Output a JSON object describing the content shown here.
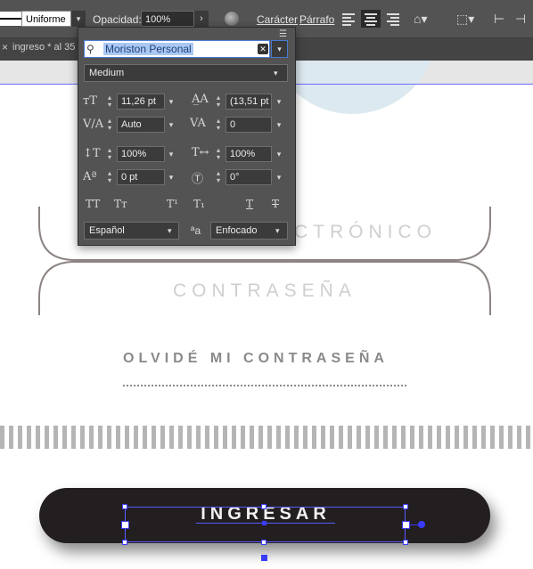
{
  "control_bar": {
    "stroke_style": "Uniforme",
    "opacity_label": "Opacidad:",
    "opacity_value": "100%",
    "character_link": "Carácter",
    "paragraph_link": "Párrafo"
  },
  "document_tab": {
    "title": "ingreso * al 35"
  },
  "character_panel": {
    "font_family": "Moriston Personal",
    "font_style": "Medium",
    "font_size": "11,26 pt",
    "leading": "(13,51 pt",
    "kerning": "Auto",
    "tracking": "0",
    "vertical_scale": "100%",
    "horizontal_scale": "100%",
    "baseline_shift": "0 pt",
    "rotation": "0°",
    "language": "Español",
    "antialiasing": "Enfocado",
    "type_buttons": [
      "TT",
      "Tт",
      "T¹",
      "T₁",
      "T",
      "T"
    ]
  },
  "canvas": {
    "email_label_partial": "CTRÓNICO",
    "password_label": "CONTRASEÑA",
    "forgot_password": "OLVIDÉ MI CONTRASEÑA",
    "login_button": "INGRESAR"
  },
  "colors": {
    "panel_bg": "#535353",
    "selection_blue": "#3b3bff",
    "button_dark": "#231f20"
  }
}
